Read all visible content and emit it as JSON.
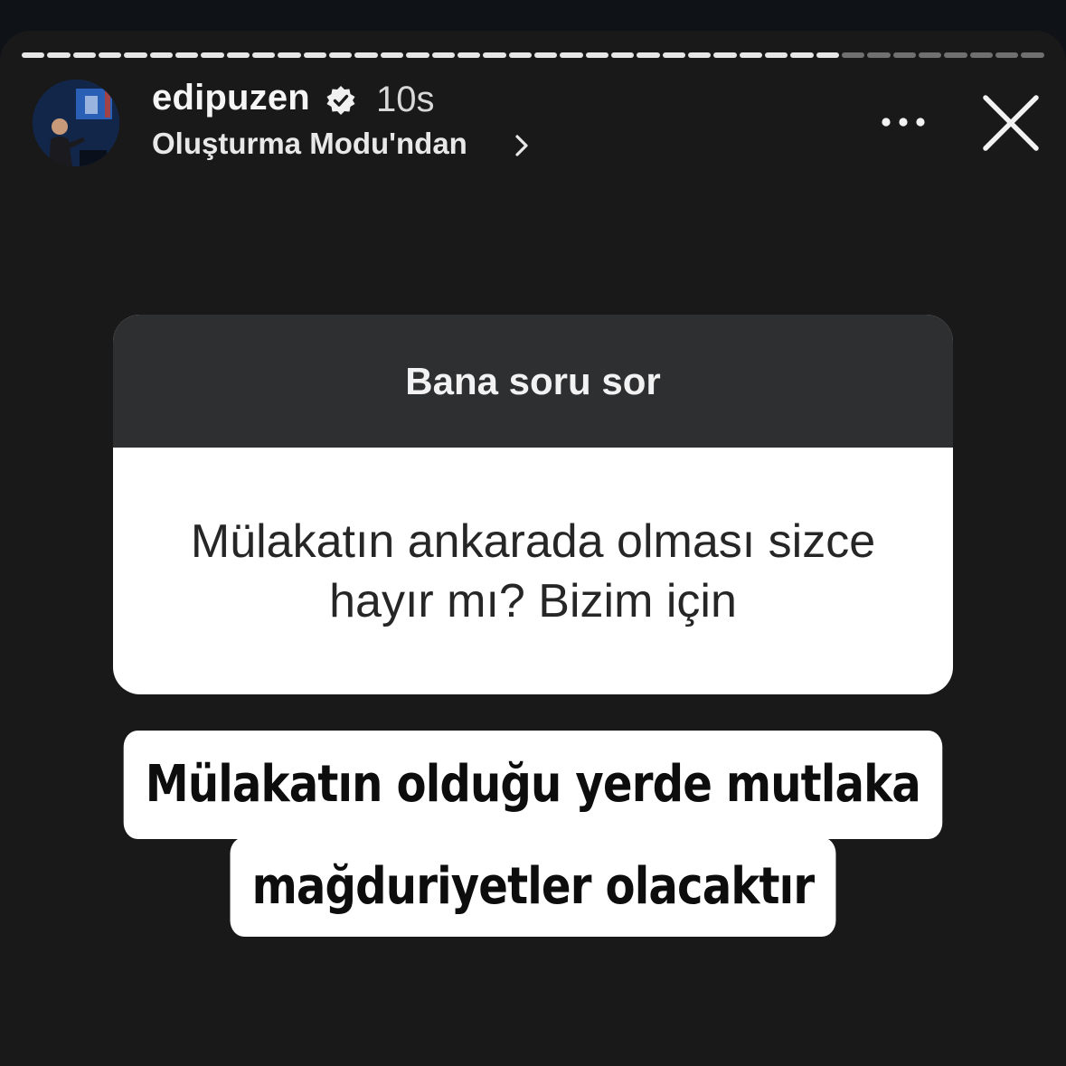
{
  "story": {
    "progress_done_fraction": 0.81,
    "segment_count": 40
  },
  "header": {
    "username": "edipuzen",
    "verified_icon": "verified-badge-icon",
    "timestamp": "10s",
    "source_label": "Oluşturma Modu'ndan",
    "source_chevron_icon": "chevron-right-icon",
    "more_icon": "more-horizontal-icon",
    "close_icon": "close-icon"
  },
  "question_sticker": {
    "title": "Bana soru sor",
    "question": "Mülakatın ankarada olması sizce hayır mı? Bizim için"
  },
  "answer": {
    "line1": "Mülakatın olduğu yerde mutlaka",
    "line2": "mağduriyetler olacaktır"
  },
  "colors": {
    "background": "#191919",
    "sticker_header": "#2e2f31",
    "text_light": "#f5f5f5"
  }
}
